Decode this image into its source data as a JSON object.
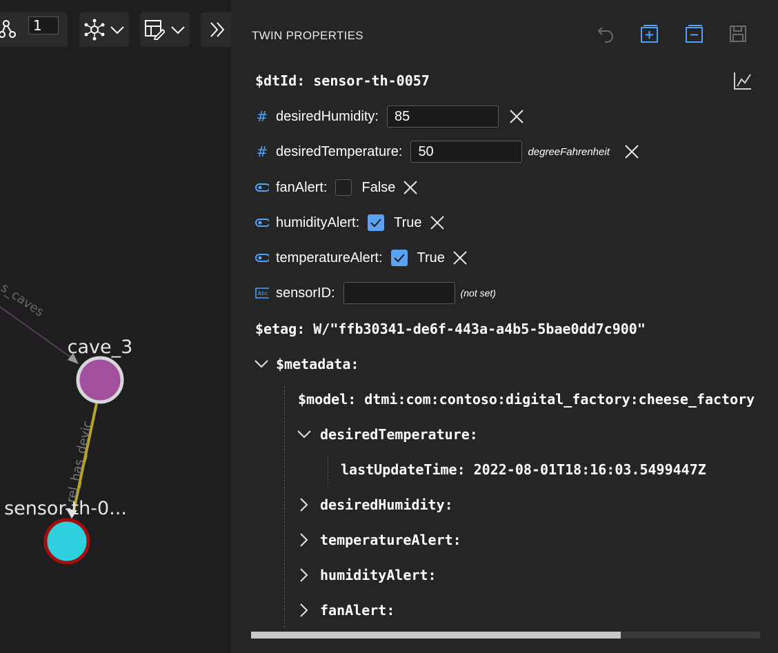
{
  "toolbar": {
    "layout_value": "1",
    "layout_icon": "graph-layout-icon",
    "physics_icon": "network-icon",
    "style_icon": "table-edit-icon",
    "expand_icon": "double-chevron-right-icon"
  },
  "graph": {
    "edge_labels": [
      "s_caves",
      "rel_has_devic"
    ],
    "nodes": [
      {
        "label": "cave_3",
        "color": "#a34fa0",
        "ring": "#d6d6d6"
      },
      {
        "label": "sensor-th-0...",
        "color": "#2ed0e0",
        "ring": "#a30f0f"
      }
    ]
  },
  "panel": {
    "title": "TWIN PROPERTIES",
    "actions": [
      "undo-icon",
      "expand-all-icon",
      "collapse-all-icon",
      "save-icon"
    ],
    "dtid_key": "$dtId:",
    "dtid_value": "sensor-th-0057",
    "chart_icon": "line-chart-icon",
    "properties": {
      "desiredHumidity": {
        "label": "desiredHumidity:",
        "value": "85"
      },
      "desiredTemperature": {
        "label": "desiredTemperature:",
        "value": "50",
        "unit": "degreeFahrenheit"
      },
      "fanAlert": {
        "label": "fanAlert:",
        "text": "False"
      },
      "humidityAlert": {
        "label": "humidityAlert:",
        "text": "True"
      },
      "temperatureAlert": {
        "label": "temperatureAlert:",
        "text": "True"
      },
      "sensorID": {
        "label": "sensorID:",
        "value": "",
        "note": "(not set)"
      }
    },
    "etag_key": "$etag:",
    "etag_value": "W/\"ffb30341-de6f-443a-a4b5-5bae0dd7c900\"",
    "metadata": {
      "label": "$metadata:",
      "model_key": "$model:",
      "model_value": "dtmi:com:contoso:digital_factory:cheese_factory",
      "desiredTemperature": "desiredTemperature:",
      "lastUpdateTime_key": "lastUpdateTime:",
      "lastUpdateTime_value": "2022-08-01T18:16:03.5499447Z",
      "desiredHumidity": "desiredHumidity:",
      "temperatureAlert": "temperatureAlert:",
      "humidityAlert": "humidityAlert:",
      "fanAlert": "fanAlert:"
    }
  }
}
